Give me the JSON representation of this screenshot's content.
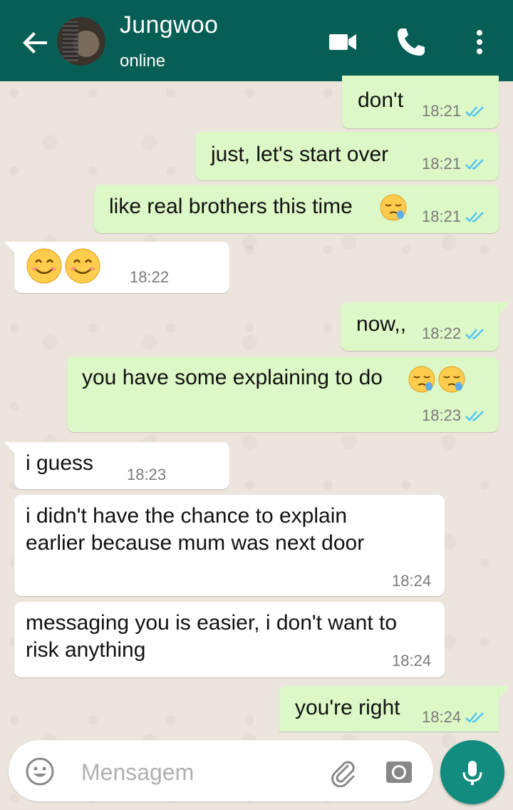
{
  "header": {
    "contact_name": "Jungwoo",
    "status": "online",
    "color": "#075e54"
  },
  "messages": [
    {
      "direction": "out",
      "text": "don't",
      "time": "18:21",
      "read": true
    },
    {
      "direction": "out",
      "text": "just, let's start over",
      "time": "18:21",
      "read": true
    },
    {
      "direction": "out",
      "text": "like real brothers this time",
      "emoji": "sleepy-face",
      "time": "18:21",
      "read": true
    },
    {
      "direction": "in",
      "emoji": "smiling-face-with-smiling-eyes x2",
      "time": "18:22"
    },
    {
      "direction": "out",
      "text": "now,,",
      "time": "18:22",
      "read": true
    },
    {
      "direction": "out",
      "text": "you have some explaining to do",
      "emoji": "sleepy-face x2",
      "time": "18:23",
      "read": true
    },
    {
      "direction": "in",
      "text": "i guess",
      "time": "18:23"
    },
    {
      "direction": "in",
      "line1": "i didn't have the chance to explain",
      "line2": "earlier because mum was next door",
      "time": "18:24"
    },
    {
      "direction": "in",
      "line1": "messaging you is easier, i don't want to",
      "line2": "risk anything",
      "time": "18:24"
    },
    {
      "direction": "out",
      "text": "you're right",
      "time": "18:24",
      "read": true
    }
  ],
  "composer": {
    "placeholder": "Mensagem",
    "icons": [
      "smiley-icon",
      "paperclip-icon",
      "camera-icon",
      "microphone-icon"
    ]
  },
  "colors": {
    "outgoing_bubble": "#dcf8c6",
    "incoming_bubble": "#ffffff",
    "read_ticks": "#4fc3f7",
    "accent": "#128c7e"
  }
}
